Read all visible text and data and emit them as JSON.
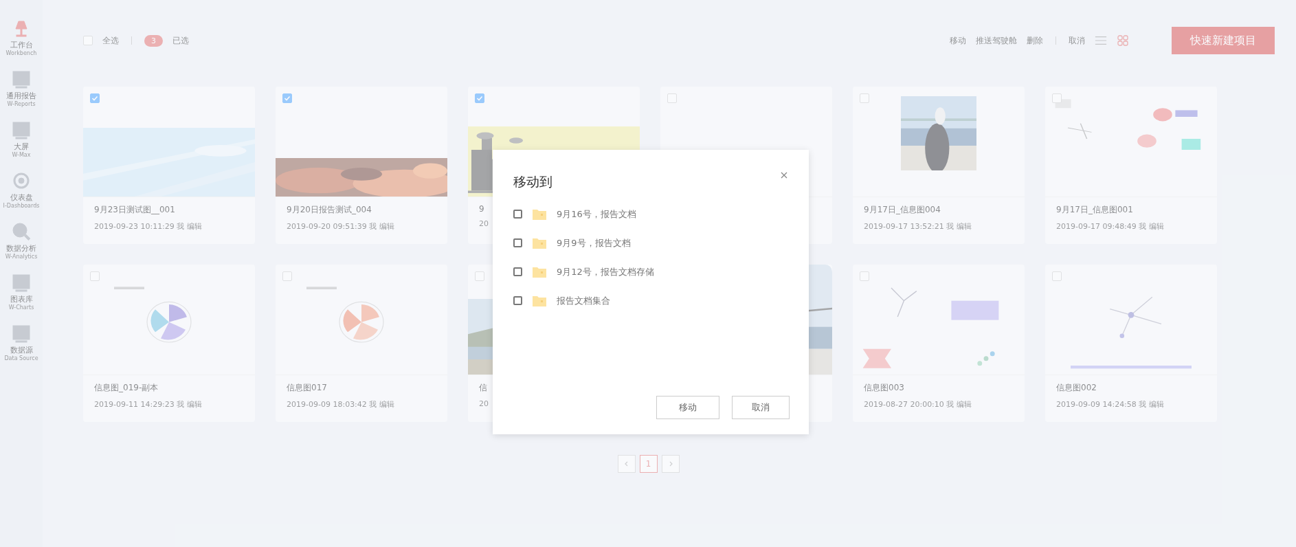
{
  "sidebar": {
    "items": [
      {
        "label": "工作台",
        "sublabel": "Workbench",
        "selected": true
      },
      {
        "label": "通用报告",
        "sublabel": "W-Reports",
        "selected": false
      },
      {
        "label": "大屏",
        "sublabel": "W-Max",
        "selected": false
      },
      {
        "label": "仪表盘",
        "sublabel": "I-Dashboards",
        "selected": false
      },
      {
        "label": "数据分析",
        "sublabel": "W-Analytics",
        "selected": false
      },
      {
        "label": "图表库",
        "sublabel": "W-Charts",
        "selected": false
      },
      {
        "label": "数据源",
        "sublabel": "Data Source",
        "selected": false
      }
    ]
  },
  "toolbar": {
    "select_all": {
      "label": "全选",
      "checked": false
    },
    "selected_count": "3",
    "selected_label": "已选",
    "actions": [
      "移动",
      "推送驾驶舱",
      "删除"
    ],
    "cancel": "取消",
    "view_icons": [
      {
        "kind": "list",
        "selected": false
      },
      {
        "kind": "grid",
        "selected": true
      }
    ],
    "create_button": "快速新建项目"
  },
  "cards": [
    {
      "title": "9月23日测试图__001",
      "meta": "2019-09-23 10:11:29 我 编辑",
      "checked": true,
      "thumbnail": {
        "kind": "picture"
      }
    },
    {
      "title": "9月20日报告测试_004",
      "meta": "2019-09-20 09:51:39 我 编辑",
      "checked": true,
      "thumbnail": {
        "kind": "picture"
      }
    },
    {
      "title": "9",
      "meta": "20",
      "checked": true,
      "thumbnail": {
        "kind": "picture"
      }
    },
    {
      "checked": false
    },
    {
      "title": "9月17日_信息图004",
      "meta": "2019-09-17 13:52:21 我 编辑",
      "checked": false,
      "thumbnail": {
        "kind": "picture"
      }
    },
    {
      "title": "9月17日_信息图001",
      "meta": "2019-09-17 09:48:49 我 编辑",
      "checked": false,
      "thumbnail": {
        "kind": "picture"
      }
    },
    {
      "title": "信息图_019-副本",
      "meta": "2019-09-11 14:29:23 我 编辑",
      "checked": false,
      "thumbnail": {
        "kind": "picture"
      }
    },
    {
      "title": "信息图017",
      "meta": "2019-09-09 18:03:42 我 编辑",
      "checked": false,
      "thumbnail": {
        "kind": "picture"
      }
    },
    {
      "title": "信",
      "meta": "20",
      "checked": false,
      "thumbnail": {
        "kind": "picture"
      }
    },
    {
      "thumbnail": {
        "kind": "picture"
      }
    },
    {
      "title": "信息图003",
      "meta": "2019-08-27 20:00:10 我 编辑",
      "checked": false,
      "thumbnail": {
        "kind": "picture"
      }
    },
    {
      "title": "信息图002",
      "meta": "2019-09-09 14:24:58 我 编辑",
      "checked": false,
      "thumbnail": {
        "kind": "picture"
      }
    }
  ],
  "pagination": {
    "pages": [
      {
        "label": "1",
        "selected": true
      }
    ],
    "prev_disabled": true,
    "next_disabled": true
  },
  "dialog": {
    "title": "移动到",
    "folders": [
      {
        "name": "9月16号，报告文档",
        "checked": false
      },
      {
        "name": "9月9号，报告文档",
        "checked": false
      },
      {
        "name": "9月12号，报告文档存储",
        "checked": false
      },
      {
        "name": "报告文档集合",
        "checked": false
      }
    ],
    "buttons": [
      {
        "label": "移动",
        "kind": "primary"
      },
      {
        "label": "取消",
        "kind": "cancel"
      }
    ]
  }
}
